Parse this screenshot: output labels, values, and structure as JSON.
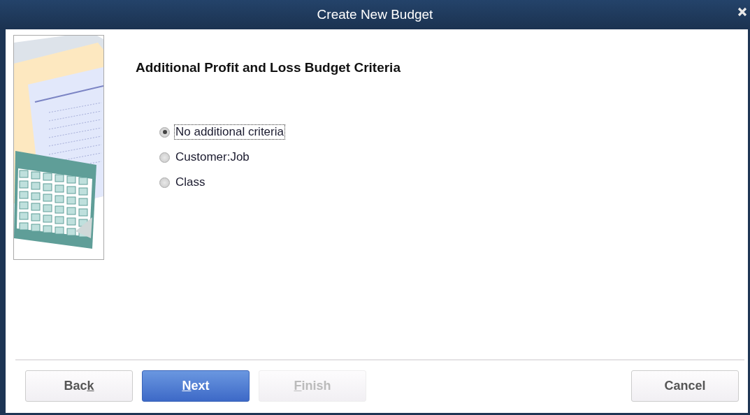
{
  "window": {
    "title": "Create New Budget"
  },
  "heading": "Additional Profit and Loss Budget Criteria",
  "options": [
    {
      "label": "No additional criteria",
      "selected": true,
      "focused": true
    },
    {
      "label": "Customer:Job",
      "selected": false,
      "focused": false
    },
    {
      "label": "Class",
      "selected": false,
      "focused": false
    }
  ],
  "buttons": [
    {
      "label_before": "Bac",
      "access_key": "k",
      "kind": "normal",
      "disabled": false
    },
    {
      "access_key": "N",
      "label_after": "ext",
      "kind": "primary",
      "disabled": false
    },
    {
      "access_key": "F",
      "label_after": "inish",
      "kind": "normal",
      "disabled": true
    },
    {
      "label": "Cancel",
      "kind": "spacer-normal",
      "disabled": false
    }
  ]
}
